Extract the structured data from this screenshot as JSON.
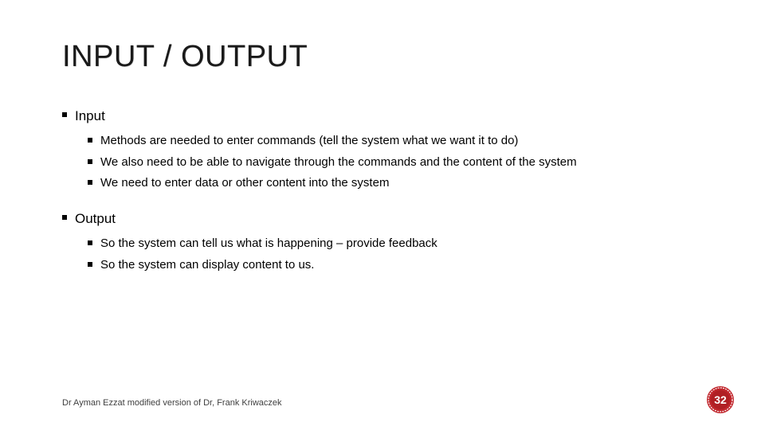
{
  "title": "INPUT / OUTPUT",
  "sections": [
    {
      "heading": "Input",
      "items": [
        "Methods are needed to enter commands (tell the system what we want it to do)",
        "We also need to be able to navigate through the commands and the content of the system",
        "We need to enter data or other content into the system"
      ]
    },
    {
      "heading": "Output",
      "items": [
        "So the system can tell us what is happening – provide feedback",
        "So the system can display content to us."
      ]
    }
  ],
  "footer": "Dr Ayman Ezzat modified version of Dr, Frank Kriwaczek",
  "pageNumber": "32",
  "colors": {
    "badge": "#c1272d",
    "badgeInner": "#b01f24"
  }
}
